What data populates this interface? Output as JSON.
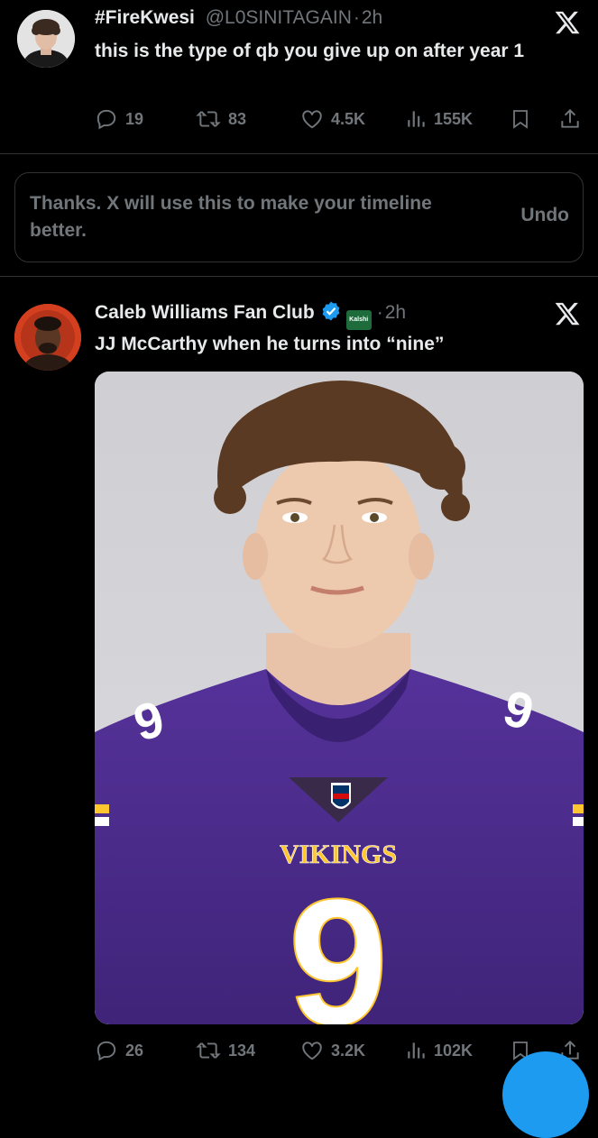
{
  "tweet1": {
    "display_name": "#FireKwesi",
    "handle": "@L0SINITAGAIN",
    "separator": "·",
    "time": "2h",
    "text": "this is the type of qb you give up on after year 1",
    "replies": "19",
    "reposts": "83",
    "likes": "4.5K",
    "views": "155K"
  },
  "feedback": {
    "message": "Thanks. X will use this to make your timeline better.",
    "undo_label": "Undo"
  },
  "tweet2": {
    "display_name": "Caleb Williams Fan Club",
    "affiliate_label": "Kalshi",
    "separator": "·",
    "time": "2h",
    "text": "JJ McCarthy when he turns into “nine”",
    "jersey_team": "VIKINGS",
    "jersey_number": "9",
    "replies": "26",
    "reposts": "134",
    "likes": "3.2K",
    "views": "102K"
  },
  "colors": {
    "background": "#000000",
    "text_primary": "#e7e9ea",
    "text_secondary": "#71767b",
    "verified_blue": "#1d9bf0",
    "jersey_purple": "#4f2683",
    "jersey_gold": "#ffc62f"
  },
  "icons": [
    "x-logo-icon",
    "reply-icon",
    "repost-icon",
    "like-icon",
    "views-icon",
    "bookmark-icon",
    "share-icon",
    "verified-badge-icon"
  ]
}
